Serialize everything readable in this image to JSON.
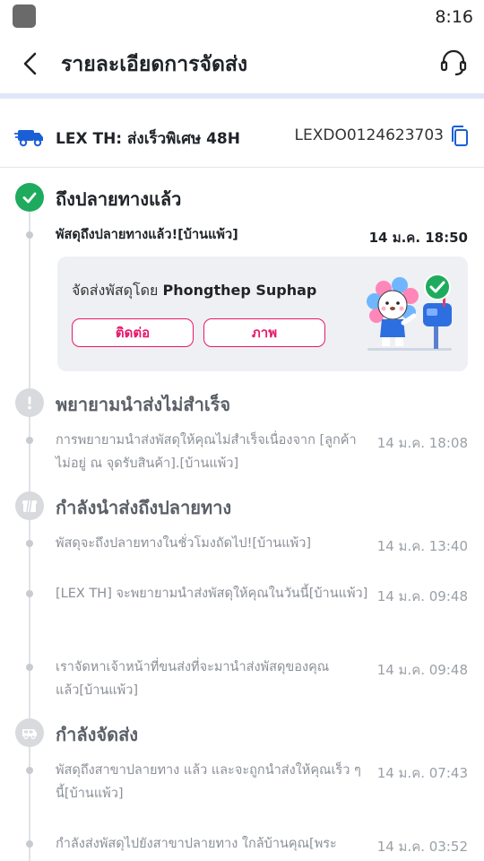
{
  "status_bar": {
    "time": "8:16"
  },
  "header": {
    "title": "รายละเอียดการจัดส่ง"
  },
  "carrier": {
    "name": "LEX TH: ส่งเร็วพิเศษ 48H",
    "tracking_number": "LEXDO0124623703"
  },
  "delivered": {
    "title": "ถึงปลายทางแล้ว",
    "event": {
      "text": "พัสดุถึงปลายทางแล้ว![บ้านแพ้ว]",
      "time": "14 ม.ค. 18:50"
    },
    "card": {
      "delivered_by_label": "จัดส่งพัสดุโดย",
      "courier_name": "Phongthep Suphap",
      "contact_button": "ติดต่อ",
      "photo_button": "ภาพ"
    }
  },
  "failed_attempt": {
    "title": "พยายามนำส่งไม่สำเร็จ",
    "events": [
      {
        "text": "การพยายามนำส่งพัสดุให้คุณไม่สำเร็จเนื่องจาก [ลูกค้าไม่อยู่ ณ จุดรับสินค้า].[บ้านแพ้ว]",
        "time": "14 ม.ค. 18:08"
      }
    ]
  },
  "out_for_delivery": {
    "title": "กำลังนำส่งถึงปลายทาง",
    "events": [
      {
        "text": "พัสดุจะถึงปลายทางในชั่วโมงถัดไป![บ้านแพ้ว]",
        "time": "14 ม.ค. 13:40"
      },
      {
        "text": "[LEX TH] จะพยายามนำส่งพัสดุให้คุณในวันนี้[บ้านแพ้ว]",
        "time": "14 ม.ค. 09:48"
      },
      {
        "text": "เราจัดหาเจ้าหน้าที่ขนส่งที่จะมานำส่งพัสดุของคุณแล้ว[บ้านแพ้ว]",
        "time": "14 ม.ค. 09:48"
      }
    ]
  },
  "in_transit": {
    "title": "กำลังจัดส่ง",
    "events": [
      {
        "text": "พัสดุถึงสาขาปลายทาง แล้ว และจะถูกนำส่งให้คุณเร็ว ๆ นี้[บ้านแพ้ว]",
        "time": "14 ม.ค. 07:43"
      },
      {
        "text": "กำลังส่งพัสดุไปยังสาขาปลายทาง ใกล้บ้านคุณ[พระ",
        "time": "14 ม.ค. 03:52"
      }
    ]
  },
  "colors": {
    "accent": "#e8176b",
    "success": "#1fab5e",
    "brand_blue": "#1a5fd6"
  },
  "icons": [
    "back-arrow-icon",
    "headset-icon",
    "truck-icon",
    "copy-icon",
    "check-icon",
    "exclamation-icon",
    "gift-box-icon",
    "van-icon"
  ]
}
